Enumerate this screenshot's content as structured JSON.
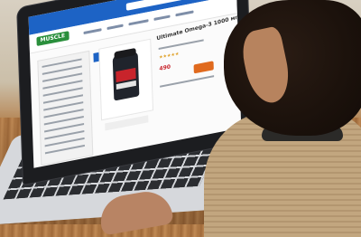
{
  "scene": {
    "description_colors": {
      "screen_brand": "#1d63c5",
      "logo_green": "#2a8f3c",
      "price_red": "#c8242b",
      "buy_orange": "#e06a1e"
    }
  },
  "website": {
    "logo": "MUSCLE",
    "product_title": "Ultimate Omega-3 1000 мг, 90 капс",
    "rating_stars": "★★★★★",
    "price": "490"
  }
}
